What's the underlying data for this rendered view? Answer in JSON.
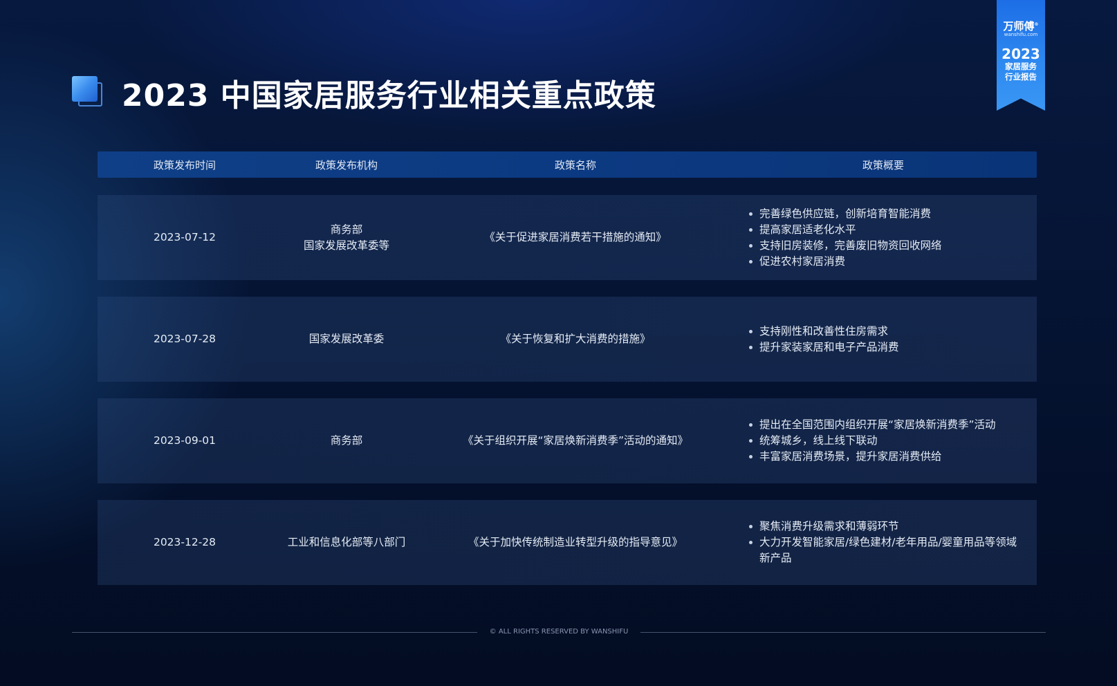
{
  "title": "2023 中国家居服务行业相关重点政策",
  "badge": {
    "brand": "万师傅",
    "registered": "®",
    "site": "wanshifu.com",
    "year": "2023",
    "line1": "家居服务",
    "line2": "行业报告"
  },
  "table": {
    "headers": [
      "政策发布时间",
      "政策发布机构",
      "政策名称",
      "政策概要"
    ],
    "rows": [
      {
        "date": "2023-07-12",
        "orgs": [
          "商务部",
          "国家发展改革委等"
        ],
        "name": "《关于促进家居消费若干措施的通知》",
        "summary": [
          "完善绿色供应链，创新培育智能消费",
          "提高家居适老化水平",
          "支持旧房装修，完善废旧物资回收网络",
          "促进农村家居消费"
        ]
      },
      {
        "date": "2023-07-28",
        "orgs": [
          "国家发展改革委"
        ],
        "name": "《关于恢复和扩大消费的措施》",
        "summary": [
          "支持刚性和改善性住房需求",
          "提升家装家居和电子产品消费"
        ]
      },
      {
        "date": "2023-09-01",
        "orgs": [
          "商务部"
        ],
        "name": "《关于组织开展“家居焕新消费季”活动的通知》",
        "summary": [
          "提出在全国范围内组织开展“家居焕新消费季”活动",
          "统筹城乡，线上线下联动",
          "丰富家居消费场景，提升家居消费供给"
        ]
      },
      {
        "date": "2023-12-28",
        "orgs": [
          "工业和信息化部等八部门"
        ],
        "name": "《关于加快传统制造业转型升级的指导意见》",
        "summary": [
          "聚焦消费升级需求和薄弱环节",
          "大力开发智能家居/绿色建材/老年用品/婴童用品等领域新产品"
        ]
      }
    ]
  },
  "footer": {
    "copyright": "© ALL RIGHTS RESERVED BY WANSHIFU"
  }
}
